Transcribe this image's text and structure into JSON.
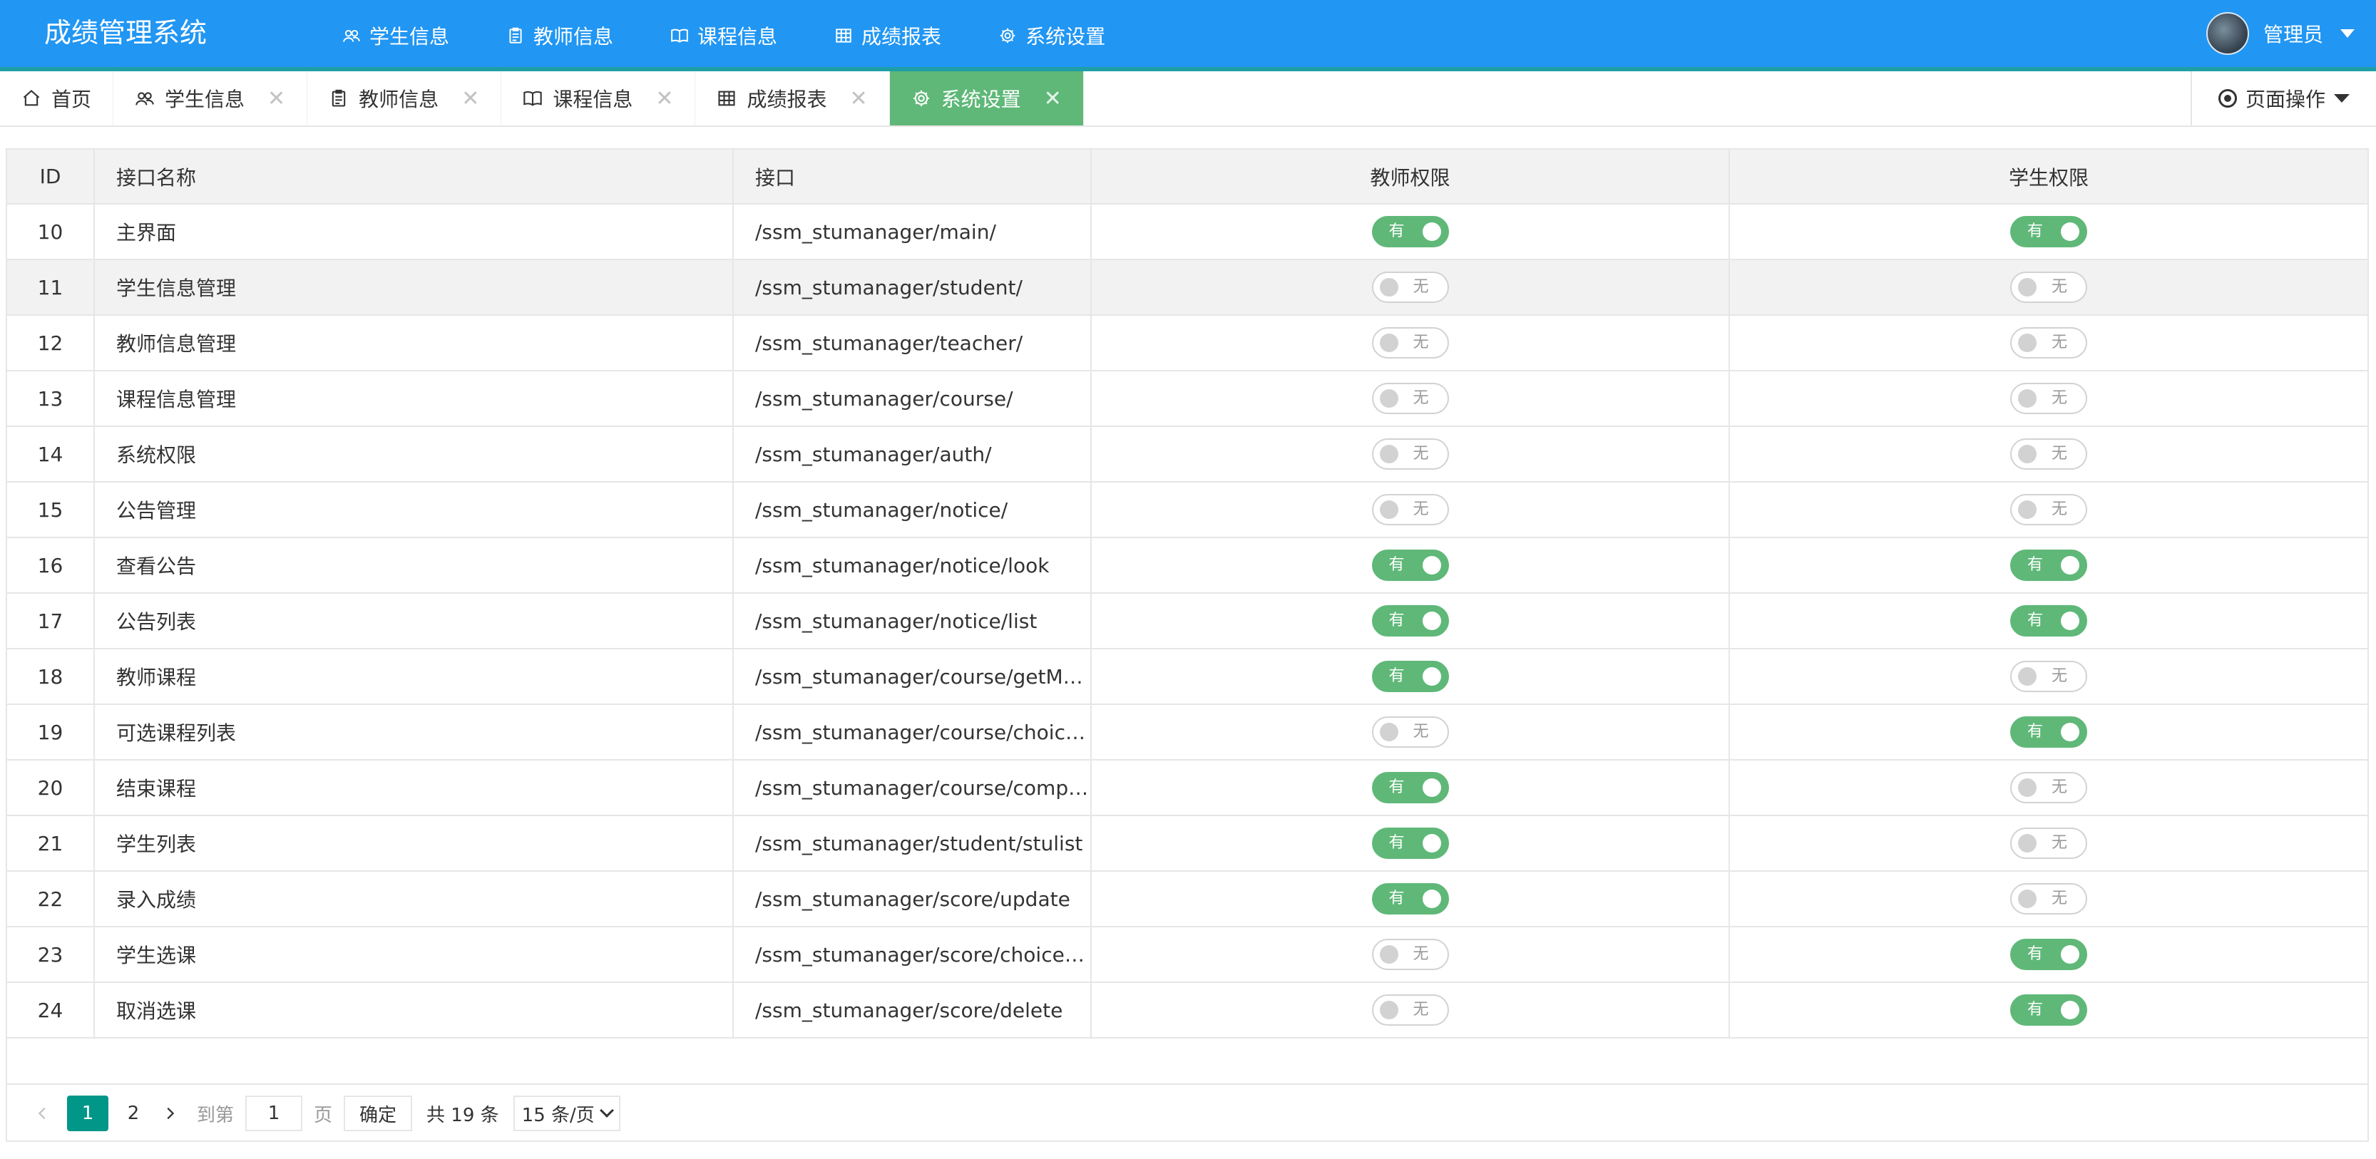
{
  "app": {
    "title": "成绩管理系统",
    "nav": [
      {
        "label": "学生信息",
        "icon": "users-icon"
      },
      {
        "label": "教师信息",
        "icon": "clipboard-icon"
      },
      {
        "label": "课程信息",
        "icon": "book-icon"
      },
      {
        "label": "成绩报表",
        "icon": "table-icon"
      },
      {
        "label": "系统设置",
        "icon": "gear-icon",
        "active": true
      }
    ],
    "user": {
      "name": "管理员"
    }
  },
  "tabs": {
    "items": [
      {
        "label": "首页",
        "icon": "home-icon"
      },
      {
        "label": "学生信息",
        "icon": "users-icon"
      },
      {
        "label": "教师信息",
        "icon": "clipboard-icon"
      },
      {
        "label": "课程信息",
        "icon": "book-icon"
      },
      {
        "label": "成绩报表",
        "icon": "table-icon"
      },
      {
        "label": "系统设置",
        "icon": "gear-icon",
        "active": true
      }
    ],
    "close_glyph": "✕",
    "page_ops_label": "页面操作"
  },
  "table": {
    "headers": {
      "id": "ID",
      "name": "接口名称",
      "api": "接口",
      "teacher": "教师权限",
      "student": "学生权限"
    },
    "on_text": "有",
    "off_text": "无",
    "rows": [
      {
        "id": "10",
        "name": "主界面",
        "api": "/ssm_stumanager/main/",
        "teacher": true,
        "student": true
      },
      {
        "id": "11",
        "name": "学生信息管理",
        "api": "/ssm_stumanager/student/",
        "teacher": false,
        "student": false
      },
      {
        "id": "12",
        "name": "教师信息管理",
        "api": "/ssm_stumanager/teacher/",
        "teacher": false,
        "student": false
      },
      {
        "id": "13",
        "name": "课程信息管理",
        "api": "/ssm_stumanager/course/",
        "teacher": false,
        "student": false
      },
      {
        "id": "14",
        "name": "系统权限",
        "api": "/ssm_stumanager/auth/",
        "teacher": false,
        "student": false
      },
      {
        "id": "15",
        "name": "公告管理",
        "api": "/ssm_stumanager/notice/",
        "teacher": false,
        "student": false
      },
      {
        "id": "16",
        "name": "查看公告",
        "api": "/ssm_stumanager/notice/look",
        "teacher": true,
        "student": true
      },
      {
        "id": "17",
        "name": "公告列表",
        "api": "/ssm_stumanager/notice/list",
        "teacher": true,
        "student": true
      },
      {
        "id": "18",
        "name": "教师课程",
        "api": "/ssm_stumanager/course/getMy…",
        "teacher": true,
        "student": false
      },
      {
        "id": "19",
        "name": "可选课程列表",
        "api": "/ssm_stumanager/course/choice…",
        "teacher": false,
        "student": true
      },
      {
        "id": "20",
        "name": "结束课程",
        "api": "/ssm_stumanager/course/compl…",
        "teacher": true,
        "student": false
      },
      {
        "id": "21",
        "name": "学生列表",
        "api": "/ssm_stumanager/student/stulist",
        "teacher": true,
        "student": false
      },
      {
        "id": "22",
        "name": "录入成绩",
        "api": "/ssm_stumanager/score/update",
        "teacher": true,
        "student": false
      },
      {
        "id": "23",
        "name": "学生选课",
        "api": "/ssm_stumanager/score/choice…",
        "teacher": false,
        "student": true
      },
      {
        "id": "24",
        "name": "取消选课",
        "api": "/ssm_stumanager/score/delete",
        "teacher": false,
        "student": true
      }
    ]
  },
  "pagination": {
    "pages": [
      "1",
      "2"
    ],
    "current": "1",
    "goto_label": "到第",
    "goto_value": "1",
    "page_unit": "页",
    "confirm_label": "确定",
    "total_label": "共 19 条",
    "page_size_label": "15 条/页"
  },
  "colors": {
    "header_bg": "#2196f3",
    "accent_green": "#5fb878",
    "pager_active": "#009688"
  }
}
